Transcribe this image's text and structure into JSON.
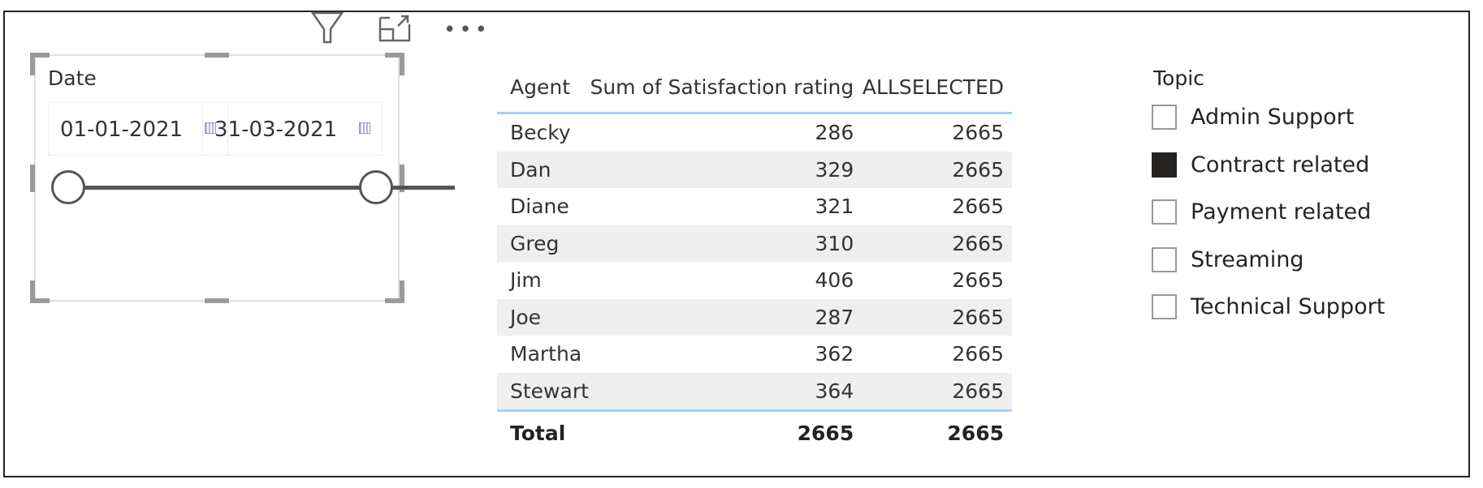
{
  "visual_header": {
    "icons": [
      "filter-icon",
      "focus-mode-icon",
      "more-options-icon"
    ]
  },
  "date_slicer": {
    "title": "Date",
    "start_date": "01-01-2021",
    "end_date": "31-03-2021",
    "range_selected_fraction": [
      0,
      1
    ]
  },
  "table": {
    "columns": [
      "Agent",
      "Sum of Satisfaction rating",
      "ALLSELECTED"
    ],
    "rows": [
      [
        "Becky",
        "286",
        "2665"
      ],
      [
        "Dan",
        "329",
        "2665"
      ],
      [
        "Diane",
        "321",
        "2665"
      ],
      [
        "Greg",
        "310",
        "2665"
      ],
      [
        "Jim",
        "406",
        "2665"
      ],
      [
        "Joe",
        "287",
        "2665"
      ],
      [
        "Martha",
        "362",
        "2665"
      ],
      [
        "Stewart",
        "364",
        "2665"
      ]
    ],
    "total": [
      "Total",
      "2665",
      "2665"
    ]
  },
  "topic_slicer": {
    "title": "Topic",
    "items": [
      {
        "label": "Admin Support",
        "checked": false
      },
      {
        "label": "Contract related",
        "checked": true
      },
      {
        "label": "Payment related",
        "checked": false
      },
      {
        "label": "Streaming",
        "checked": false
      },
      {
        "label": "Technical Support",
        "checked": false
      }
    ]
  },
  "colors": {
    "accent_line": "#a6d0f5",
    "alt_row": "#efefef",
    "checked_fill": "#252423"
  }
}
